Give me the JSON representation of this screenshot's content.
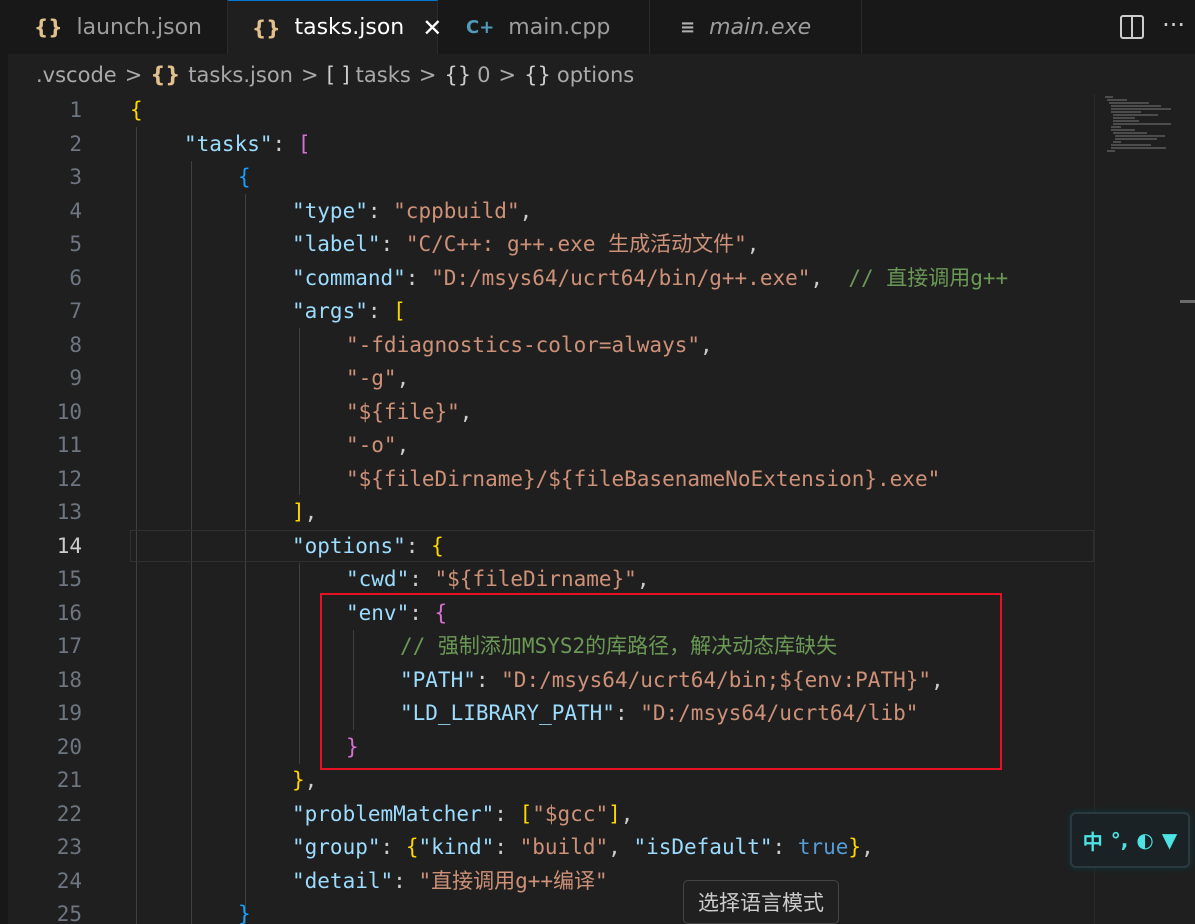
{
  "tabs": [
    {
      "icon": "{}",
      "label": "launch.json"
    },
    {
      "icon": "{}",
      "label": "tasks.json",
      "close": "✕"
    },
    {
      "icon": "C+",
      "label": "main.cpp"
    },
    {
      "icon": "≡",
      "label": "main.exe"
    }
  ],
  "tab_actions": {
    "more": "···"
  },
  "breadcrumb": {
    "folder": ".vscode",
    "file_icon": "{}",
    "file": "tasks.json",
    "array_icon": "[ ]",
    "array": "tasks",
    "obj_icon": "{}",
    "index": "0",
    "obj_icon2": "{}",
    "prop": "options",
    "sep": ">"
  },
  "editor": {
    "current_line": 14,
    "line_numbers": [
      "1",
      "2",
      "3",
      "4",
      "5",
      "6",
      "7",
      "8",
      "9",
      "10",
      "11",
      "12",
      "13",
      "14",
      "15",
      "16",
      "17",
      "18",
      "19",
      "20",
      "21",
      "22",
      "23",
      "24",
      "25"
    ],
    "tokens": {
      "open_brace": "{",
      "tasks_key": "\"tasks\"",
      "colon": ": ",
      "open_bracket": "[",
      "open_brace2": "{",
      "type_key": "\"type\"",
      "type_val": "\"cppbuild\"",
      "comma": ",",
      "label_key": "\"label\"",
      "label_val": "\"C/C++: g++.exe 生成活动文件\"",
      "command_key": "\"command\"",
      "command_val": "\"D:/msys64/ucrt64/bin/g++.exe\"",
      "command_comment": "// 直接调用g++",
      "args_key": "\"args\"",
      "arg1": "\"-fdiagnostics-color=always\"",
      "arg2": "\"-g\"",
      "arg3": "\"${file}\"",
      "arg4": "\"-o\"",
      "arg5": "\"${fileDirname}/${fileBasenameNoExtension}.exe\"",
      "close_bracket": "]",
      "options_key": "\"options\"",
      "cwd_key": "\"cwd\"",
      "cwd_val": "\"${fileDirname}\"",
      "env_key": "\"env\"",
      "env_comment": "// 强制添加MSYS2的库路径，解决动态库缺失",
      "path_key": "\"PATH\"",
      "path_val": "\"D:/msys64/ucrt64/bin;${env:PATH}\"",
      "ld_key": "\"LD_LIBRARY_PATH\"",
      "ld_val": "\"D:/msys64/ucrt64/lib\"",
      "close_brace": "}",
      "problem_key": "\"problemMatcher\"",
      "problem_val": "\"$gcc\"",
      "group_key": "\"group\"",
      "kind_key": "\"kind\"",
      "kind_val": "\"build\"",
      "isdefault_key": "\"isDefault\"",
      "true_val": "true",
      "detail_key": "\"detail\"",
      "detail_val": "\"直接调用g++编译\""
    }
  },
  "ime": {
    "lang": "中",
    "punct": "°,"
  },
  "tooltip": "选择语言模式",
  "colors": {
    "highlight_box": "#e81123",
    "accent": "#0078d4"
  }
}
